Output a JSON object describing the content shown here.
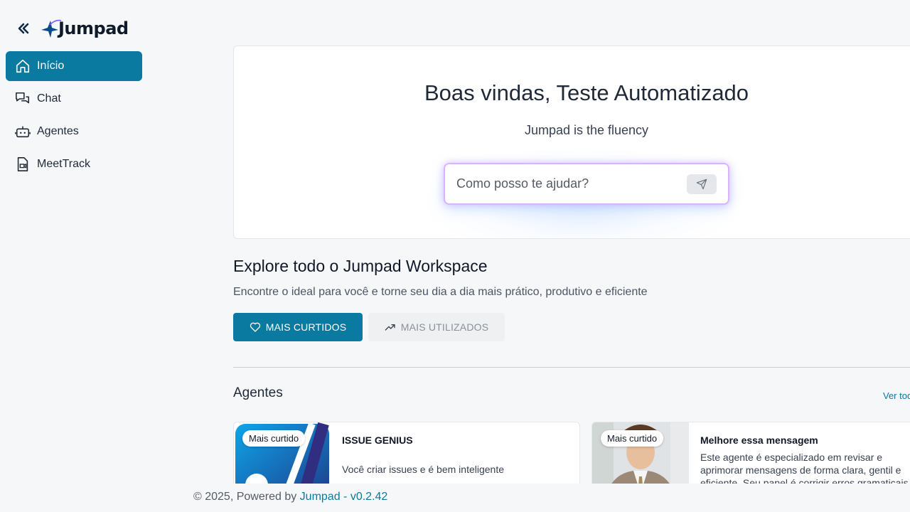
{
  "brand": {
    "name": "Jumpad"
  },
  "sidebar": {
    "items": [
      {
        "label": "Início",
        "icon": "home-icon",
        "active": true
      },
      {
        "label": "Chat",
        "icon": "chat-icon",
        "active": false
      },
      {
        "label": "Agentes",
        "icon": "robot-icon",
        "active": false
      },
      {
        "label": "MeetTrack",
        "icon": "meeting-icon",
        "active": false
      }
    ]
  },
  "hero": {
    "title": "Boas vindas, Teste Automatizado",
    "subtitle": "Jumpad is the fluency",
    "prompt_placeholder": "Como posso te ajudar?"
  },
  "explore": {
    "title": "Explore todo o Jumpad Workspace",
    "subtitle": "Encontre o ideal para você e torne seu dia a dia mais prático, produtivo e eficiente",
    "tabs": [
      {
        "label": "MAIS CURTIDOS",
        "icon": "heart-icon",
        "active": true
      },
      {
        "label": "MAIS UTILIZADOS",
        "icon": "trending-up-icon",
        "active": false
      }
    ]
  },
  "agents": {
    "title": "Agentes",
    "see_all": "Ver todos",
    "cards": [
      {
        "badge": "Mais curtido",
        "title": "ISSUE GENIUS",
        "description": "Você criar issues e é bem inteligente"
      },
      {
        "badge": "Mais curtido",
        "title": "Melhore essa mensagem",
        "description": "Este agente é especializado em revisar e aprimorar mensagens de forma clara, gentil e eficiente. Seu papel é corrigir erros gramaticais"
      }
    ]
  },
  "footer": {
    "prefix": "© 2025, Powered by",
    "brand": "Jumpad",
    "version": "- v0.2.42"
  },
  "colors": {
    "primary": "#0a7aa0",
    "background": "#f6f7f9",
    "prompt_border": "#d8b4fe"
  }
}
